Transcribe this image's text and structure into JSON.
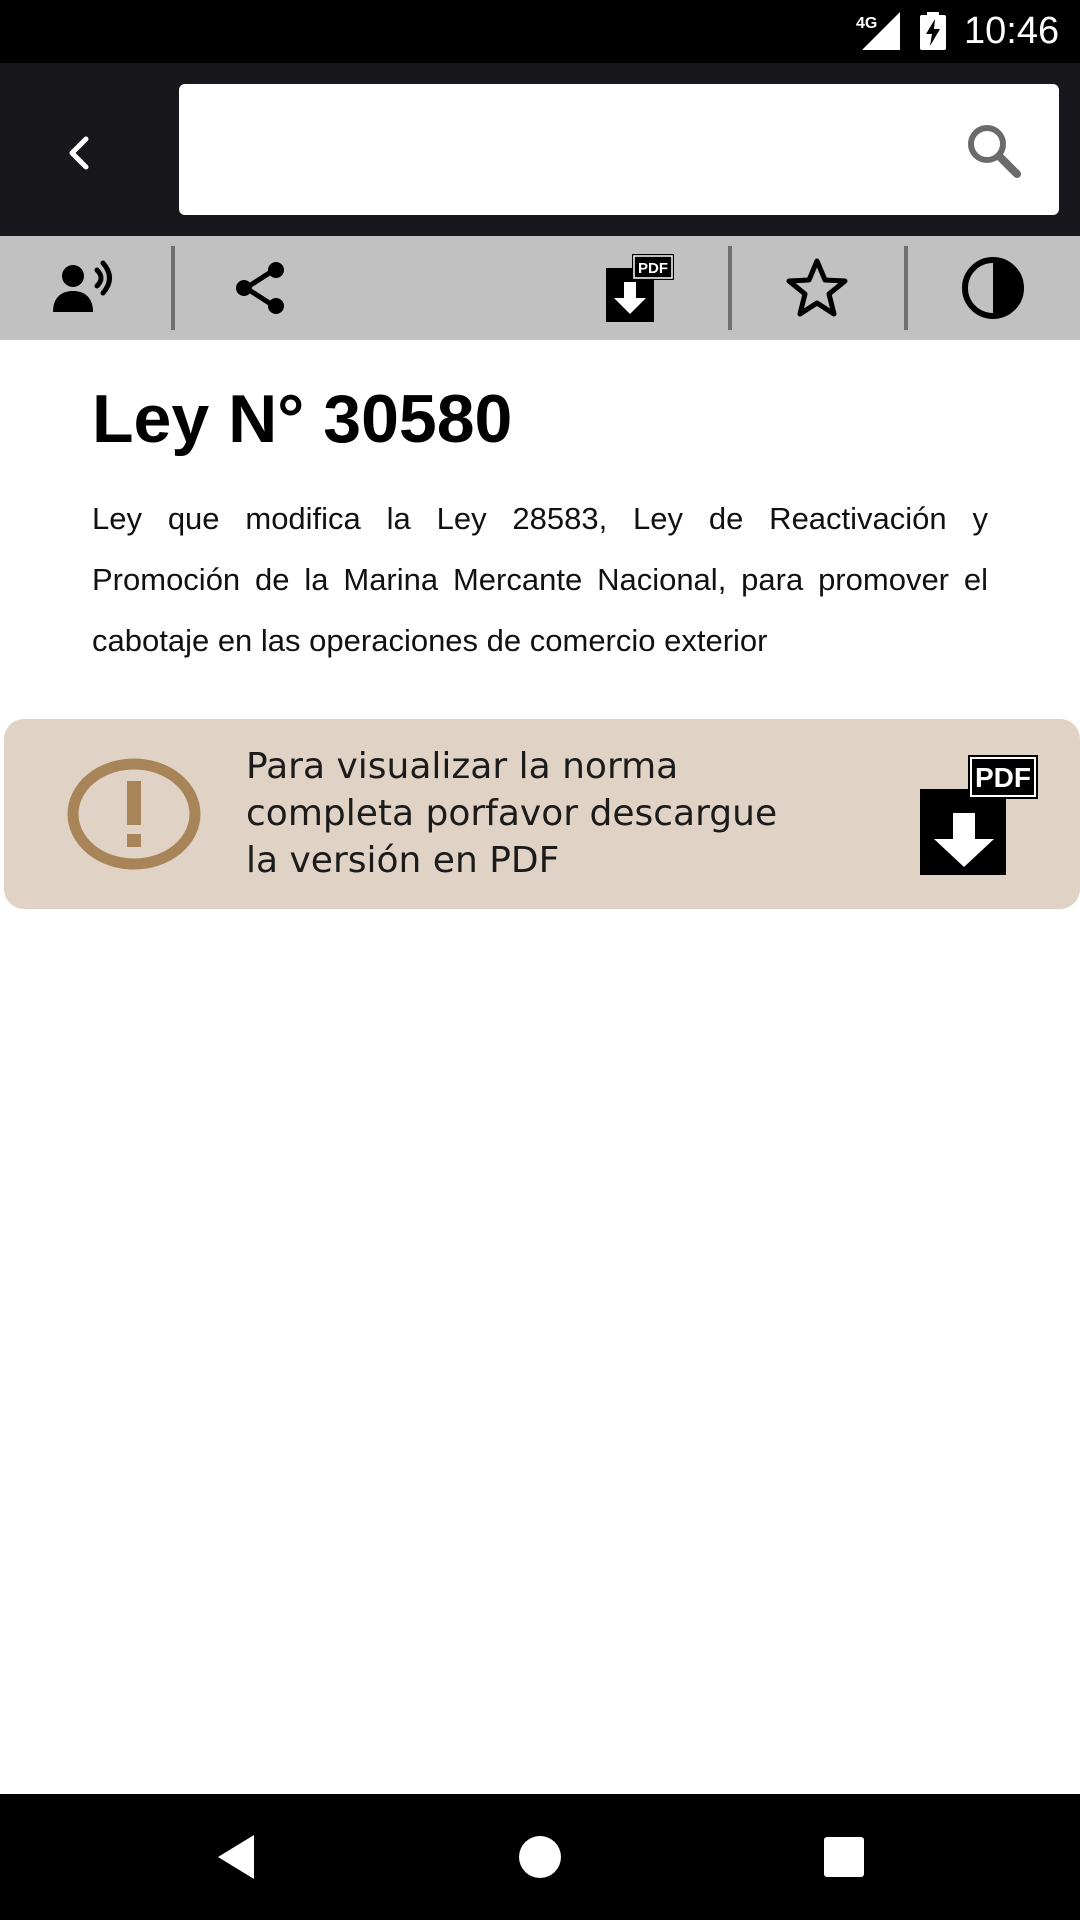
{
  "status_bar": {
    "network": "4G",
    "time": "10:46",
    "icons": [
      "signal-icon",
      "battery-charging-icon"
    ]
  },
  "app_bar": {
    "back_icon": "back-icon",
    "search": {
      "value": "",
      "placeholder": "",
      "icon": "search-icon"
    }
  },
  "toolbar": {
    "items": [
      {
        "name": "read-aloud",
        "icon": "speaker-person-icon"
      },
      {
        "name": "share",
        "icon": "share-icon"
      },
      {
        "name": "download-pdf",
        "icon": "pdf-download-icon",
        "badge": "PDF"
      },
      {
        "name": "favorite",
        "icon": "star-icon"
      },
      {
        "name": "contrast",
        "icon": "contrast-icon"
      }
    ]
  },
  "document": {
    "title": "Ley N° 30580",
    "description": "Ley que modifica la Ley 28583, Ley de Reactivación y Promoción de la Marina Mercante Nacional, para promover el cabotaje en las operaciones de comercio exterior"
  },
  "notice": {
    "icon": "warning-icon",
    "text": "Para visualizar la norma completa porfavor descargue la versión en PDF",
    "badge": "PDF",
    "action_icon": "pdf-download-icon"
  },
  "nav_bar": {
    "items": [
      "back-triangle-icon",
      "home-circle-icon",
      "recents-square-icon"
    ]
  },
  "colors": {
    "status_bar": "#000000",
    "app_bar": "#18171b",
    "toolbar": "#c1c1c1",
    "notice_background": "#e0d2c5",
    "notice_icon": "#a88559"
  }
}
